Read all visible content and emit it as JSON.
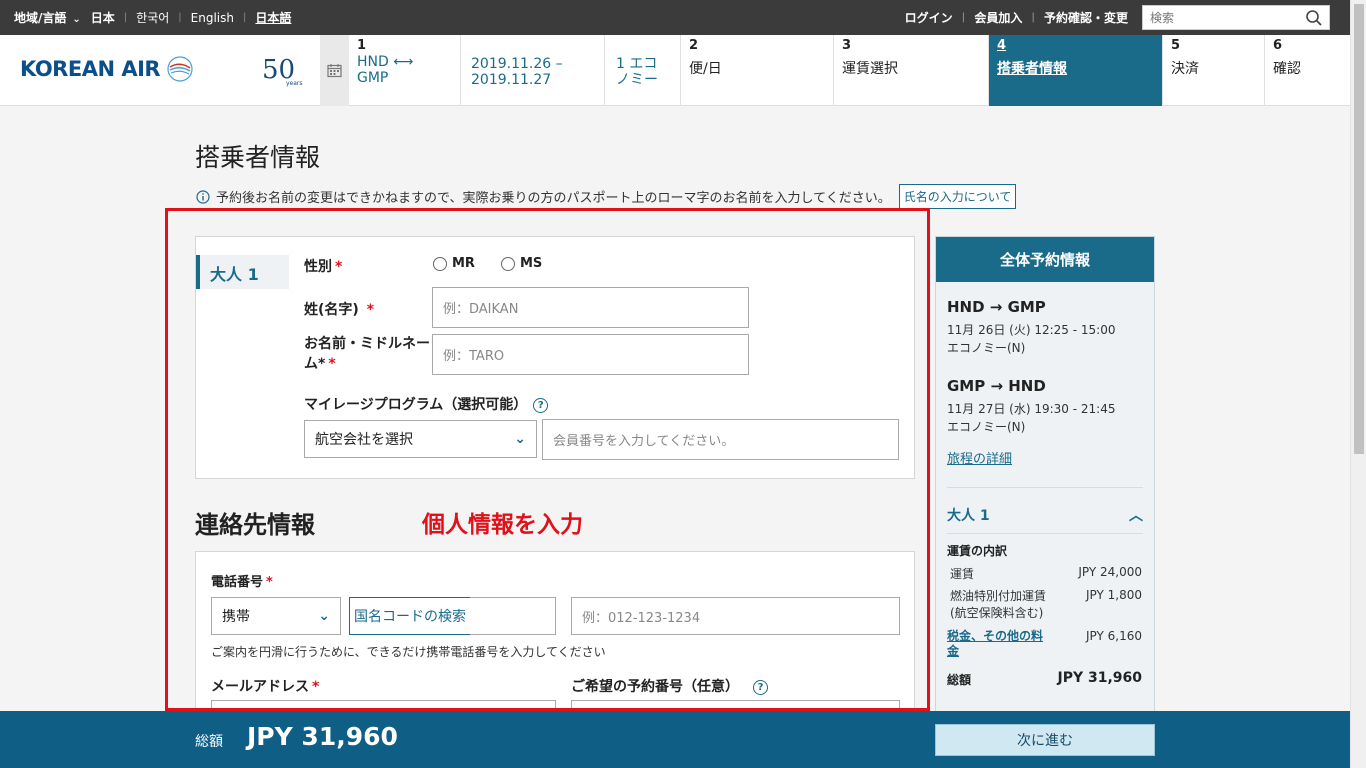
{
  "topbar": {
    "region_label": "地域/言語",
    "country": "日本",
    "lang_ko": "한국어",
    "lang_en": "English",
    "lang_ja": "日本語",
    "login": "ログイン",
    "join": "会員加入",
    "manage": "予約確認・変更",
    "search_placeholder": "検索"
  },
  "header": {
    "logo_text": "KOREAN AIR",
    "anniversary": "50",
    "anniversary_sub": "years",
    "steps": [
      {
        "num": "1",
        "val1": "HND ⟷",
        "val2": "GMP"
      },
      {
        "val1": "2019.11.26 –",
        "val2": "2019.11.27"
      },
      {
        "val1": "1 エコ",
        "val2": "ノミー"
      },
      {
        "num": "2",
        "val": "便/日"
      },
      {
        "num": "3",
        "val": "運賃選択"
      },
      {
        "num": "4",
        "val": "搭乗者情報"
      },
      {
        "num": "5",
        "val": "決済"
      },
      {
        "num": "6",
        "val": "確認"
      }
    ]
  },
  "page": {
    "title": "搭乗者情報",
    "notice": "予約後お名前の変更はできかねますので、実際お乗りの方のパスポート上のローマ字のお名前を入力してください。",
    "notice_button": "氏名の入力について",
    "annotation": "個人情報を入力"
  },
  "passenger": {
    "tab": "大人 1",
    "gender_label": "性別",
    "mr": "MR",
    "ms": "MS",
    "surname_label": "姓(名字)",
    "surname_placeholder": "例：DAIKAN",
    "given_label_1": "お名前・ミドルネー",
    "given_label_2": "ム*",
    "given_placeholder": "例：TARO",
    "mileage_label": "マイレージプログラム（選択可能）",
    "airline_select": "航空会社を選択",
    "member_placeholder": "会員番号を入力してください。"
  },
  "contact": {
    "title": "連絡先情報",
    "phone_label": "電話番号",
    "phone_type": "携帯",
    "country_code_button": "国名コードの検索",
    "phone_placeholder": "例：012-123-1234",
    "phone_hint": "ご案内を円滑に行うために、できるだけ携帯電話番号を入力してください",
    "email_label": "メールアドレス",
    "pnr_label": "ご希望の予約番号（任意）"
  },
  "summary": {
    "title": "全体予約情報",
    "leg1_route": "HND → GMP",
    "leg1_time": "11月 26日 (火)  12:25 - 15:00",
    "leg1_class": "エコノミー(N)",
    "leg2_route": "GMP → HND",
    "leg2_time": "11月 27日 (水)  19:30 - 21:45",
    "leg2_class": "エコノミー(N)",
    "itinerary_link": "旅程の詳細",
    "adult": "大人 1",
    "breakdown": "運賃の内訳",
    "fare_label": "運賃",
    "fare_value": "JPY 24,000",
    "fuel_label_1": "燃油特別付加運賃",
    "fuel_label_2": "(航空保険料含む)",
    "fuel_value": "JPY 1,800",
    "tax_label_1": "税金、その他の料",
    "tax_label_2": "金",
    "tax_value": "JPY 6,160",
    "total_label": "総額",
    "total_value": "JPY 31,960"
  },
  "bottom": {
    "total_label": "総額",
    "total_value": "JPY 31,960",
    "next_button": "次に進む"
  },
  "colors": {
    "brand": "#1a6b8a",
    "topbar": "#3b3b3b",
    "bottombar": "#0f5e86",
    "annotation_red": "#e0111a"
  }
}
